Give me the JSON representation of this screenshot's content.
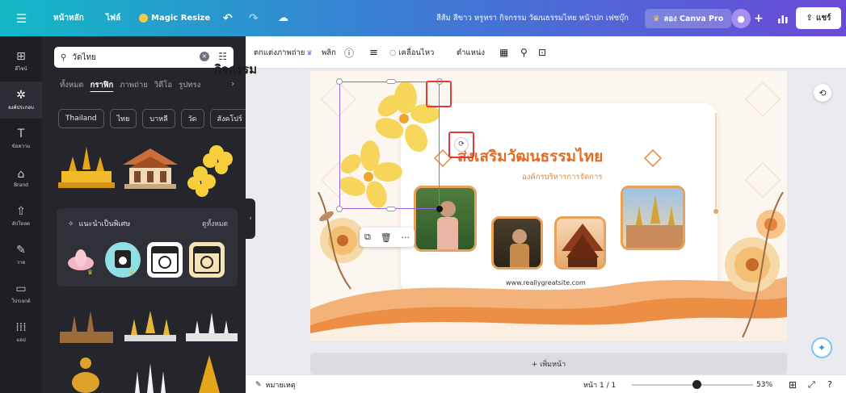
{
  "topbar": {
    "menu_icon": "menu-icon",
    "home_label": "หน้าหลัก",
    "file_label": "ไฟล์",
    "magic_resize_label": "Magic Resize",
    "undo_icon": "undo-icon",
    "redo_icon": "redo-icon",
    "cloud_icon": "cloud-save-icon",
    "doc_title": "สีส้ม สีขาว หรูหรา กิจกรรม วัฒนธรรมไทย หน้าปก เฟซบุ๊ก",
    "try_pro_label": "ลอง Canva Pro",
    "add_icon": "+",
    "stats_icon": "chart-icon",
    "share_label": "แชร์"
  },
  "rail": {
    "items": [
      {
        "label": "ดีไซน์",
        "icon": "template-icon"
      },
      {
        "label": "องค์ประกอบ",
        "icon": "elements-icon"
      },
      {
        "label": "ข้อความ",
        "icon": "text-icon"
      },
      {
        "label": "Brand",
        "icon": "brand-icon"
      },
      {
        "label": "อัปโหลด",
        "icon": "upload-icon"
      },
      {
        "label": "วาด",
        "icon": "draw-icon"
      },
      {
        "label": "โปรเจกต์",
        "icon": "folder-icon"
      },
      {
        "label": "แอป",
        "icon": "apps-icon"
      }
    ]
  },
  "panel": {
    "search_value": "วัดไทย",
    "tabs": [
      "ทั้งหมด",
      "กราฟิก",
      "ภาพถ่าย",
      "วิดีโอ",
      "รูปทรง"
    ],
    "chips": [
      "Thailand",
      "ไทย",
      "บาหลี",
      "วัด",
      "สังคโปร์"
    ],
    "suggest_title": "แนะนำเป็นพิเศษ",
    "suggest_all": "ดูทั้งหมด"
  },
  "toolbar": {
    "edit_image": "ตกแต่งภาพถ่าย",
    "flip": "พลิก",
    "animate": "เคลื่อนไหว",
    "position": "ตำแหน่ง"
  },
  "design": {
    "title": "กิจกรรม",
    "headline": "ส่งเสริมวัฒนธรรมไทย",
    "subtitle": "องค์กรบริหารการจัดการ",
    "url": "www.reallygreatsite.com"
  },
  "canvas": {
    "add_page_label": "+ เพิ่มหน้า"
  },
  "bottombar": {
    "notes_label": "หมายเหตุ",
    "page_label": "หน้า 1 / 1",
    "zoom_level": "53%",
    "zoom_fraction": 0.53
  }
}
